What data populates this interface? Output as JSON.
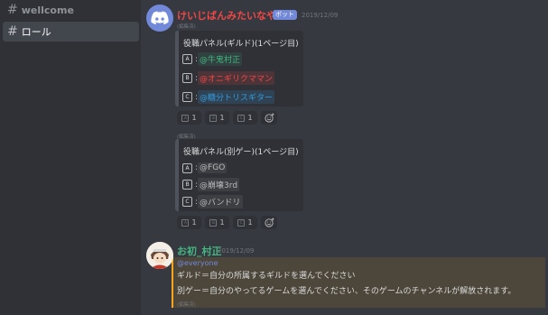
{
  "sidebar": {
    "channels": [
      {
        "label": "wellcome",
        "active": false
      },
      {
        "label": "ロール",
        "active": true
      }
    ]
  },
  "messages": {
    "bot": {
      "username": "けいじばんみたいなやつ",
      "username_color": "#f04747",
      "badge": "ボット",
      "timestamp": "2019/12/09"
    },
    "embed1": {
      "edited": "(編集済)",
      "title": "役職パネル(ギルド)(1ページ目)",
      "rows": [
        {
          "key": "A",
          "prefix": ":",
          "role": "@牛鬼村正",
          "role_color": "#43b581"
        },
        {
          "key": "B",
          "prefix": ":",
          "role": "@オニギリクママン",
          "role_color": "#f04747"
        },
        {
          "key": "C",
          "prefix": ":",
          "role": "@糖分トリスギター",
          "role_color": "#3498db"
        }
      ],
      "reactions": [
        {
          "key": "A",
          "count": "1"
        },
        {
          "key": "B",
          "count": "1"
        },
        {
          "key": "C",
          "count": "1"
        }
      ]
    },
    "embed2": {
      "edited": "(編集済)",
      "title": "役職パネル(別ゲー)(1ページ目)",
      "rows": [
        {
          "key": "A",
          "prefix": ":",
          "role": "@FGO",
          "role_color": "#b9bbbe"
        },
        {
          "key": "B",
          "prefix": ":",
          "role": "@崩壊3rd",
          "role_color": "#b9bbbe"
        },
        {
          "key": "C",
          "prefix": ":",
          "role": "@バンドリ",
          "role_color": "#b9bbbe"
        }
      ],
      "reactions": [
        {
          "key": "A",
          "count": "1"
        },
        {
          "key": "B",
          "count": "1"
        },
        {
          "key": "C",
          "count": "1"
        }
      ]
    },
    "user": {
      "username": "お初_村正",
      "username_color": "#43b581",
      "timestamp": "2019/12/09",
      "mention": "@everyone",
      "lines": [
        "ギルド＝自分の所属するギルドを選んでください",
        "別ゲー＝自分のやってるゲームを選んでください、そのゲームのチャンネルが解放されます。"
      ],
      "edited": "(編集済)"
    }
  }
}
